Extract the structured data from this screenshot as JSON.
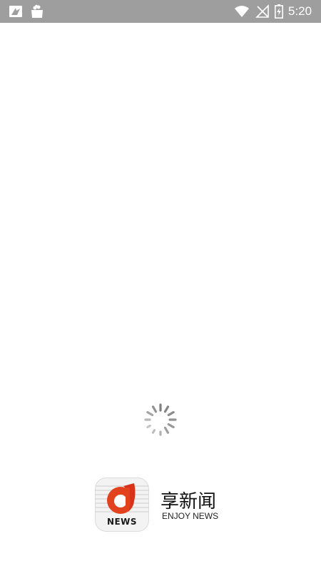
{
  "status_bar": {
    "time": "5:20",
    "icons": [
      "system-notification-icon",
      "shopping-bag-icon",
      "wifi-icon",
      "no-signal-icon",
      "battery-charging-icon"
    ]
  },
  "loading": {
    "indicator": "spinner-icon"
  },
  "brand": {
    "logo_text": "NEWS",
    "title": "享新闻",
    "subtitle": "ENJOY NEWS",
    "accent_color": "#e2431e"
  }
}
